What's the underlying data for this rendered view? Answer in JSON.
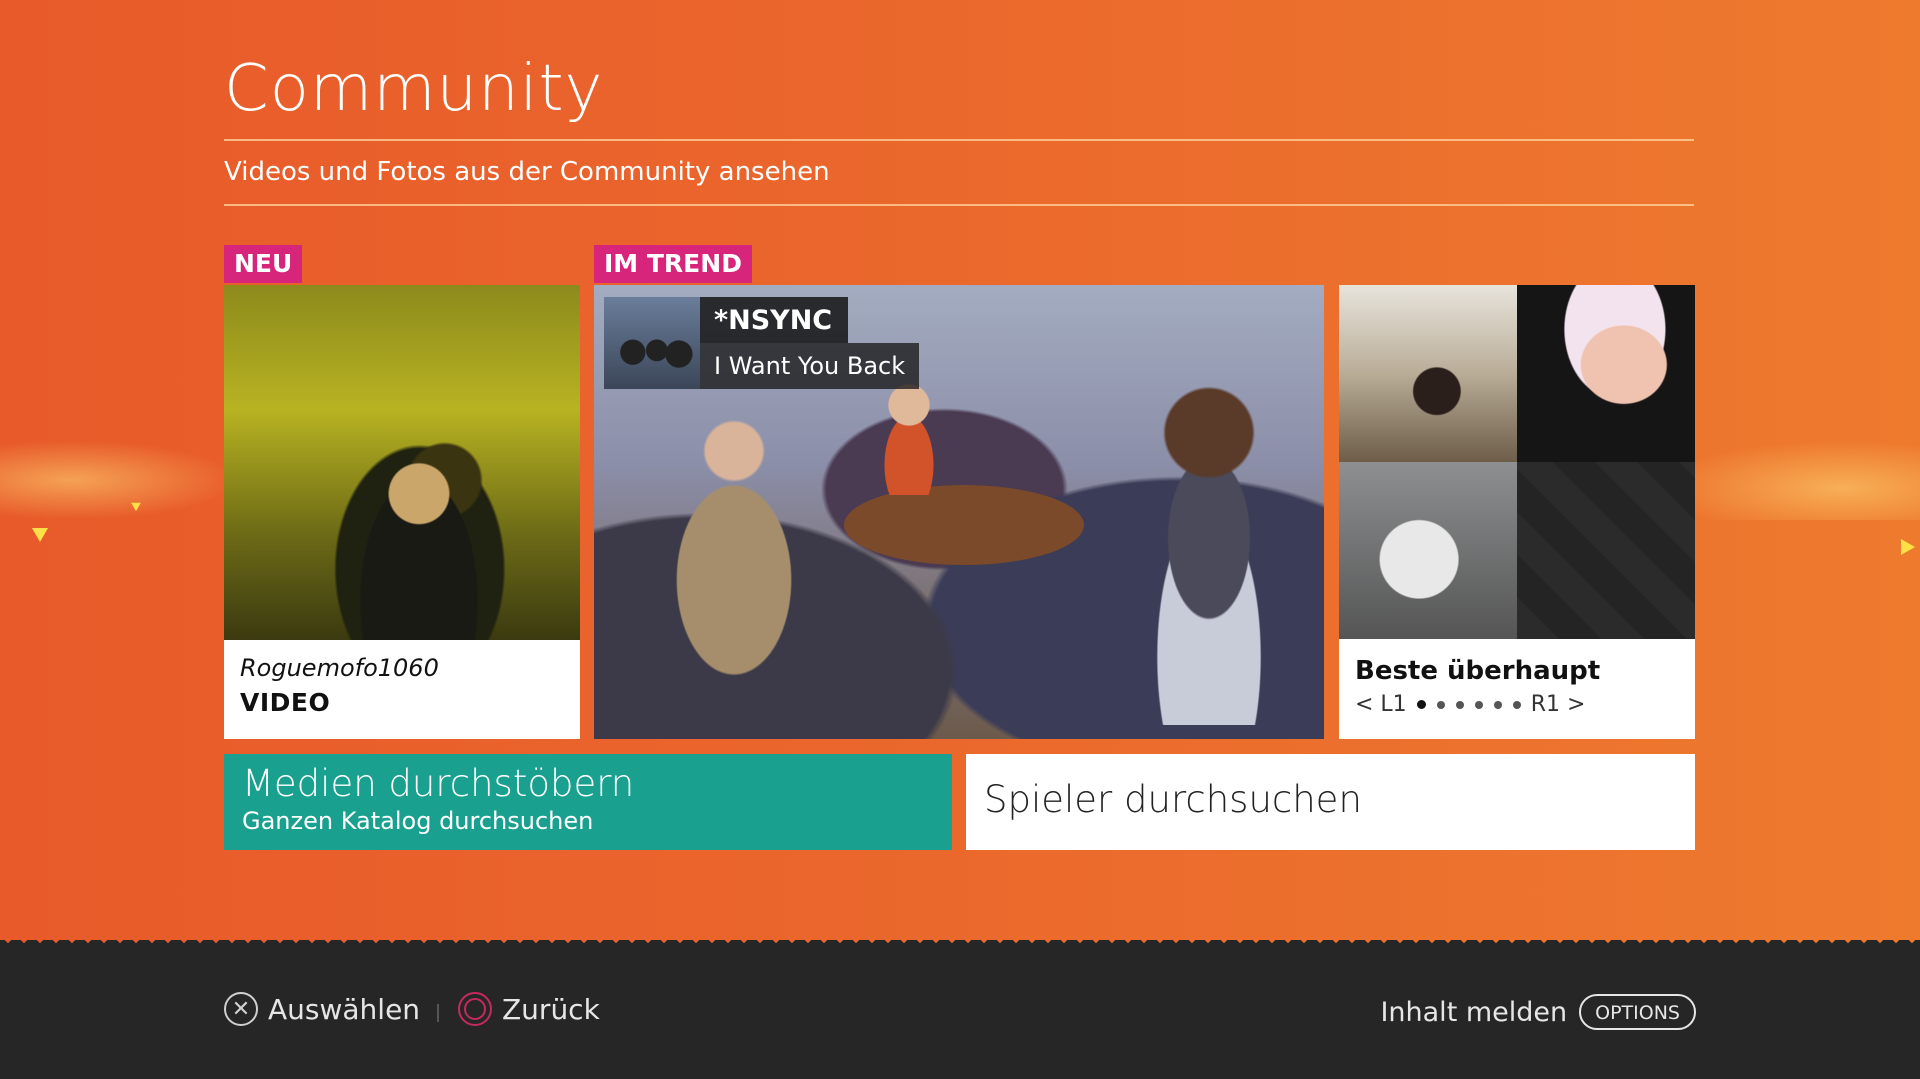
{
  "header": {
    "title": "Community",
    "subtitle": "Videos und Fotos aus der Community ansehen"
  },
  "tags": {
    "new": "NEU",
    "trending": "IM TREND"
  },
  "cards": {
    "new": {
      "user": "Roguemofo1060",
      "type": "VIDEO"
    },
    "trending": {
      "artist": "*NSYNC",
      "song": "I Want You Back"
    },
    "best": {
      "title": "Beste überhaupt",
      "pager_left": "< L1",
      "pager_right": "R1 >",
      "page_count": 6,
      "active_page": 1
    }
  },
  "actions": {
    "browse_title": "Medien durchstöbern",
    "browse_sub": "Ganzen Katalog durchsuchen",
    "search_players": "Spieler durchsuchen"
  },
  "footer": {
    "select": "Auswählen",
    "back": "Zurück",
    "report": "Inhalt melden",
    "options": "OPTIONS"
  },
  "colors": {
    "background": "#ea652c",
    "tag": "#d8257c",
    "teal": "#19a08f",
    "footer": "#262626"
  }
}
